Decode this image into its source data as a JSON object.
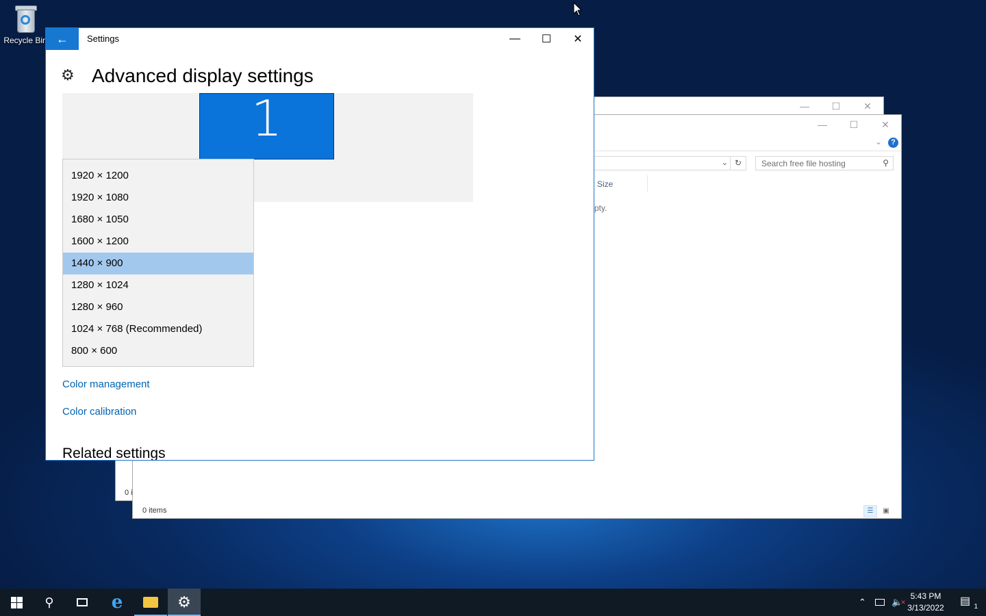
{
  "desktop": {
    "recycle_bin_label": "Recycle Bin"
  },
  "explorer_back": {
    "status": "0 i"
  },
  "explorer": {
    "search_placeholder": "Search free file hosting",
    "column_size": "Size",
    "empty_text": "pty.",
    "status": "0 items",
    "help_label": "?"
  },
  "settings": {
    "window_title": "Settings",
    "page_title": "Advanced display settings",
    "monitor_number": "1",
    "resolutions": [
      "1920 × 1200",
      "1920 × 1080",
      "1680 × 1050",
      "1600 × 1200",
      "1440 × 900",
      "1280 × 1024",
      "1280 × 960",
      "1024 × 768 (Recommended)",
      "800 × 600"
    ],
    "selected_resolution": "1440 × 900",
    "color_management": "Color management",
    "color_calibration": "Color calibration",
    "related_settings": "Related settings"
  },
  "taskbar": {
    "time": "5:43 PM",
    "date": "3/13/2022",
    "notification_count": "1"
  },
  "colors": {
    "accent": "#1778d2",
    "monitor": "#0a74da",
    "selected_row": "#a3c8ed",
    "link": "#0063b1",
    "taskbar": "#101a25"
  }
}
